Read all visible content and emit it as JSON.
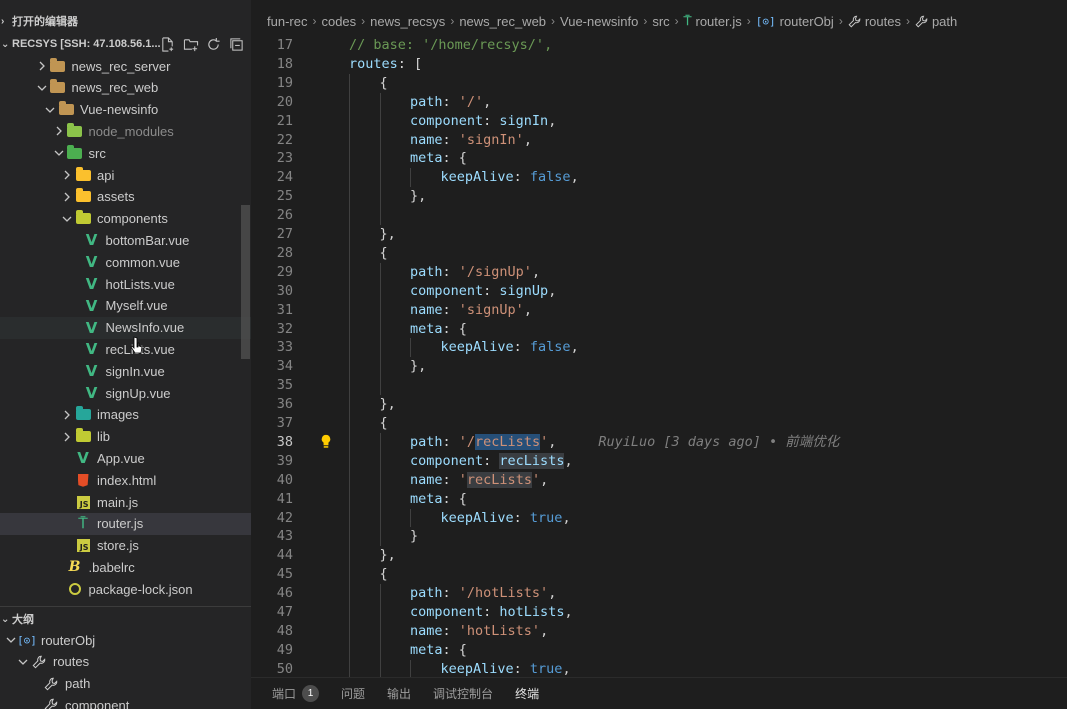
{
  "sidebar": {
    "open_editors_label": "打开的编辑器",
    "root_label": "RECSYS [SSH: 47.108.56.1...",
    "actions": [
      "new-file-icon",
      "new-folder-icon",
      "refresh-icon",
      "collapse-all-icon"
    ],
    "tree": [
      {
        "label": "news_rec_server",
        "type": "folder",
        "state": "collapsed",
        "depth": 1
      },
      {
        "label": "news_rec_web",
        "type": "folder",
        "state": "expanded",
        "depth": 1
      },
      {
        "label": "Vue-newsinfo",
        "type": "folder",
        "state": "expanded",
        "depth": 2
      },
      {
        "label": "node_modules",
        "type": "folder-node",
        "state": "collapsed",
        "depth": 3,
        "dim": true
      },
      {
        "label": "src",
        "type": "folder-src",
        "state": "expanded",
        "depth": 3
      },
      {
        "label": "api",
        "type": "folder-api",
        "state": "collapsed",
        "depth": 4
      },
      {
        "label": "assets",
        "type": "folder-assets",
        "state": "collapsed",
        "depth": 4
      },
      {
        "label": "components",
        "type": "folder-components",
        "state": "expanded",
        "depth": 4
      },
      {
        "label": "bottomBar.vue",
        "type": "vue",
        "depth": 5
      },
      {
        "label": "common.vue",
        "type": "vue",
        "depth": 5
      },
      {
        "label": "hotLists.vue",
        "type": "vue",
        "depth": 5
      },
      {
        "label": "Myself.vue",
        "type": "vue",
        "depth": 5
      },
      {
        "label": "NewsInfo.vue",
        "type": "vue",
        "depth": 5,
        "hover": true
      },
      {
        "label": "recLists.vue",
        "type": "vue",
        "depth": 5
      },
      {
        "label": "signIn.vue",
        "type": "vue",
        "depth": 5
      },
      {
        "label": "signUp.vue",
        "type": "vue",
        "depth": 5
      },
      {
        "label": "images",
        "type": "folder-images",
        "state": "collapsed",
        "depth": 4
      },
      {
        "label": "lib",
        "type": "folder-lib",
        "state": "collapsed",
        "depth": 4
      },
      {
        "label": "App.vue",
        "type": "vue",
        "depth": 4
      },
      {
        "label": "index.html",
        "type": "html",
        "depth": 4
      },
      {
        "label": "main.js",
        "type": "js",
        "depth": 4
      },
      {
        "label": "router.js",
        "type": "router",
        "depth": 4,
        "active": true
      },
      {
        "label": "store.js",
        "type": "js",
        "depth": 4
      },
      {
        "label": ".babelrc",
        "type": "babel",
        "depth": 3
      },
      {
        "label": "package-lock.json",
        "type": "json",
        "depth": 3
      }
    ],
    "outline_label": "大纲",
    "outline": [
      {
        "label": "routerObj",
        "type": "symbol",
        "state": "expanded",
        "depth": 0
      },
      {
        "label": "routes",
        "type": "wrench",
        "state": "expanded",
        "depth": 1
      },
      {
        "label": "path",
        "type": "wrench",
        "depth": 2
      },
      {
        "label": "component",
        "type": "wrench",
        "depth": 2
      }
    ]
  },
  "breadcrumb": [
    {
      "label": "fun-rec"
    },
    {
      "label": "codes"
    },
    {
      "label": "news_recsys"
    },
    {
      "label": "news_rec_web"
    },
    {
      "label": "Vue-newsinfo"
    },
    {
      "label": "src"
    },
    {
      "label": "router.js",
      "icon": "router-icon"
    },
    {
      "label": "routerObj",
      "icon": "symbol-icon"
    },
    {
      "label": "routes",
      "icon": "wrench-icon"
    },
    {
      "label": "path",
      "icon": "wrench-icon"
    }
  ],
  "editor": {
    "current_line": 38,
    "lightbulb_line": 38,
    "lines": [
      {
        "n": 17,
        "indent": 1,
        "tokens": [
          [
            "com",
            "// base: '/home/recsys/',"
          ]
        ]
      },
      {
        "n": 18,
        "indent": 1,
        "tokens": [
          [
            "key",
            "routes"
          ],
          [
            "p",
            ": ["
          ]
        ]
      },
      {
        "n": 19,
        "indent": 2,
        "tokens": [
          [
            "p",
            "{"
          ]
        ]
      },
      {
        "n": 20,
        "indent": 3,
        "tokens": [
          [
            "key",
            "path"
          ],
          [
            "p",
            ": "
          ],
          [
            "str",
            "'/'"
          ],
          [
            "p",
            ","
          ]
        ]
      },
      {
        "n": 21,
        "indent": 3,
        "tokens": [
          [
            "key",
            "component"
          ],
          [
            "p",
            ": "
          ],
          [
            "key",
            "signIn"
          ],
          [
            "p",
            ","
          ]
        ]
      },
      {
        "n": 22,
        "indent": 3,
        "tokens": [
          [
            "key",
            "name"
          ],
          [
            "p",
            ": "
          ],
          [
            "str",
            "'signIn'"
          ],
          [
            "p",
            ","
          ]
        ]
      },
      {
        "n": 23,
        "indent": 3,
        "tokens": [
          [
            "key",
            "meta"
          ],
          [
            "p",
            ": {"
          ]
        ]
      },
      {
        "n": 24,
        "indent": 4,
        "tokens": [
          [
            "key",
            "keepAlive"
          ],
          [
            "p",
            ": "
          ],
          [
            "bool",
            "false"
          ],
          [
            "p",
            ","
          ]
        ]
      },
      {
        "n": 25,
        "indent": 3,
        "tokens": [
          [
            "p",
            "},"
          ]
        ]
      },
      {
        "n": 26,
        "indent": 0,
        "tokens": []
      },
      {
        "n": 27,
        "indent": 2,
        "tokens": [
          [
            "p",
            "},"
          ]
        ]
      },
      {
        "n": 28,
        "indent": 2,
        "tokens": [
          [
            "p",
            "{"
          ]
        ]
      },
      {
        "n": 29,
        "indent": 3,
        "tokens": [
          [
            "key",
            "path"
          ],
          [
            "p",
            ": "
          ],
          [
            "str",
            "'/signUp'"
          ],
          [
            "p",
            ","
          ]
        ]
      },
      {
        "n": 30,
        "indent": 3,
        "tokens": [
          [
            "key",
            "component"
          ],
          [
            "p",
            ": "
          ],
          [
            "key",
            "signUp"
          ],
          [
            "p",
            ","
          ]
        ]
      },
      {
        "n": 31,
        "indent": 3,
        "tokens": [
          [
            "key",
            "name"
          ],
          [
            "p",
            ": "
          ],
          [
            "str",
            "'signUp'"
          ],
          [
            "p",
            ","
          ]
        ]
      },
      {
        "n": 32,
        "indent": 3,
        "tokens": [
          [
            "key",
            "meta"
          ],
          [
            "p",
            ": {"
          ]
        ]
      },
      {
        "n": 33,
        "indent": 4,
        "tokens": [
          [
            "key",
            "keepAlive"
          ],
          [
            "p",
            ": "
          ],
          [
            "bool",
            "false"
          ],
          [
            "p",
            ","
          ]
        ]
      },
      {
        "n": 34,
        "indent": 3,
        "tokens": [
          [
            "p",
            "},"
          ]
        ]
      },
      {
        "n": 35,
        "indent": 0,
        "tokens": []
      },
      {
        "n": 36,
        "indent": 2,
        "tokens": [
          [
            "p",
            "},"
          ]
        ]
      },
      {
        "n": 37,
        "indent": 2,
        "tokens": [
          [
            "p",
            "{"
          ]
        ]
      },
      {
        "n": 38,
        "indent": 3,
        "tokens": [
          [
            "key",
            "path"
          ],
          [
            "p",
            ": "
          ],
          [
            "str",
            "'/"
          ],
          [
            "str-sel",
            "recLists"
          ],
          [
            "str",
            "'"
          ],
          [
            "p",
            ","
          ]
        ],
        "blame": "RuyiLuo [3 days ago] • 前端优化"
      },
      {
        "n": 39,
        "indent": 3,
        "tokens": [
          [
            "key",
            "component"
          ],
          [
            "p",
            ": "
          ],
          [
            "key-occ",
            "recLists"
          ],
          [
            "p",
            ","
          ]
        ]
      },
      {
        "n": 40,
        "indent": 3,
        "tokens": [
          [
            "key",
            "name"
          ],
          [
            "p",
            ": "
          ],
          [
            "str",
            "'"
          ],
          [
            "str-occ",
            "recLists"
          ],
          [
            "str",
            "'"
          ],
          [
            "p",
            ","
          ]
        ]
      },
      {
        "n": 41,
        "indent": 3,
        "tokens": [
          [
            "key",
            "meta"
          ],
          [
            "p",
            ": {"
          ]
        ]
      },
      {
        "n": 42,
        "indent": 4,
        "tokens": [
          [
            "key",
            "keepAlive"
          ],
          [
            "p",
            ": "
          ],
          [
            "bool",
            "true"
          ],
          [
            "p",
            ","
          ]
        ]
      },
      {
        "n": 43,
        "indent": 3,
        "tokens": [
          [
            "p",
            "}"
          ]
        ]
      },
      {
        "n": 44,
        "indent": 2,
        "tokens": [
          [
            "p",
            "},"
          ]
        ]
      },
      {
        "n": 45,
        "indent": 2,
        "tokens": [
          [
            "p",
            "{"
          ]
        ]
      },
      {
        "n": 46,
        "indent": 3,
        "tokens": [
          [
            "key",
            "path"
          ],
          [
            "p",
            ": "
          ],
          [
            "str",
            "'/hotLists'"
          ],
          [
            "p",
            ","
          ]
        ]
      },
      {
        "n": 47,
        "indent": 3,
        "tokens": [
          [
            "key",
            "component"
          ],
          [
            "p",
            ": "
          ],
          [
            "key",
            "hotLists"
          ],
          [
            "p",
            ","
          ]
        ]
      },
      {
        "n": 48,
        "indent": 3,
        "tokens": [
          [
            "key",
            "name"
          ],
          [
            "p",
            ": "
          ],
          [
            "str",
            "'hotLists'"
          ],
          [
            "p",
            ","
          ]
        ]
      },
      {
        "n": 49,
        "indent": 3,
        "tokens": [
          [
            "key",
            "meta"
          ],
          [
            "p",
            ": {"
          ]
        ]
      },
      {
        "n": 50,
        "indent": 4,
        "tokens": [
          [
            "key",
            "keepAlive"
          ],
          [
            "p",
            ": "
          ],
          [
            "bool",
            "true"
          ],
          [
            "p",
            ","
          ]
        ]
      }
    ]
  },
  "panel": {
    "tabs": [
      {
        "label": "端口",
        "badge": "1"
      },
      {
        "label": "问题"
      },
      {
        "label": "输出"
      },
      {
        "label": "调试控制台"
      },
      {
        "label": "终端",
        "active": true
      }
    ]
  },
  "colors": {
    "accent": "#007acc",
    "vue": "#41b883",
    "js": "#cbcb41",
    "html": "#e44d26"
  }
}
